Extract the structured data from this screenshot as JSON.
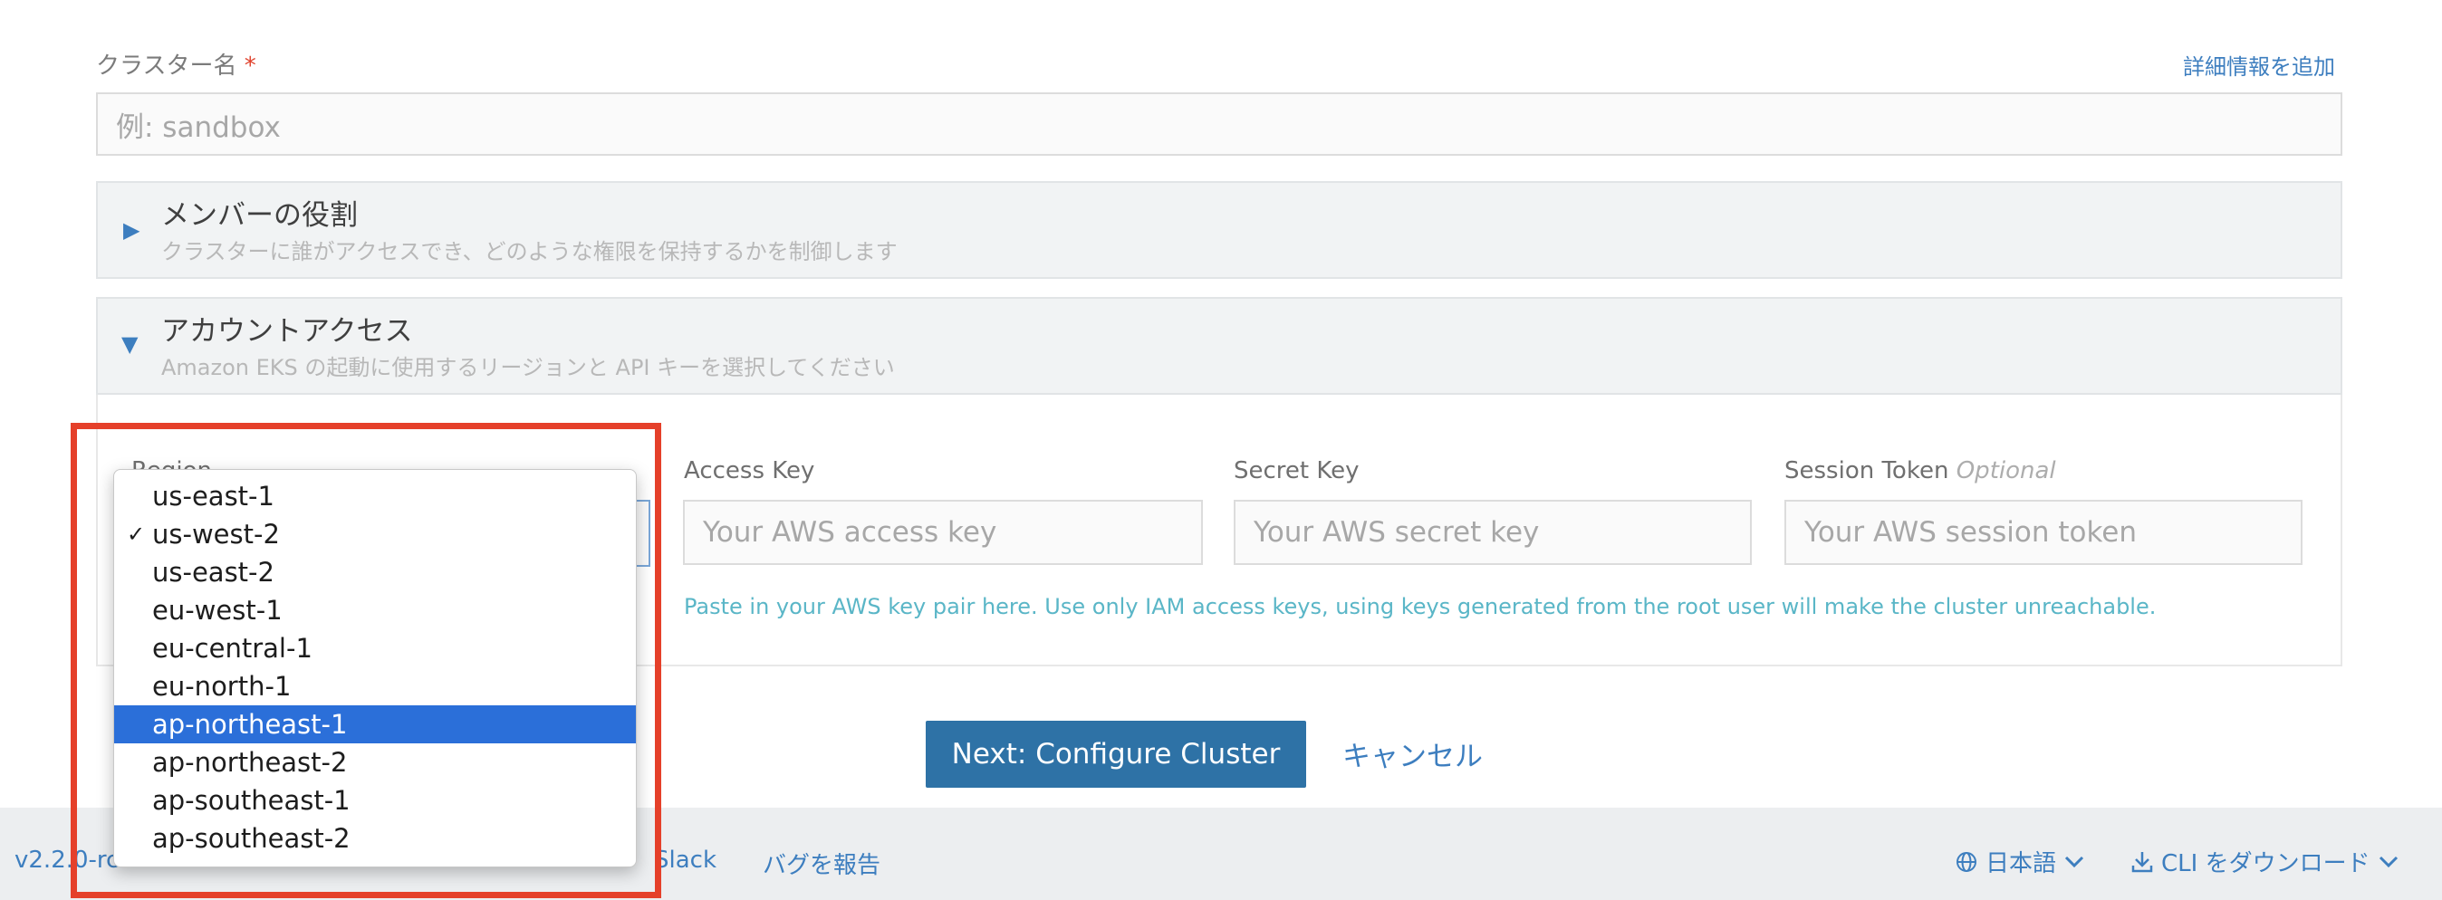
{
  "cluster_name": {
    "label": "クラスター名",
    "required_mark": "*",
    "add_details_link": "詳細情報を追加",
    "placeholder": "例: sandbox"
  },
  "member_roles": {
    "title": "メンバーの役割",
    "subtitle": "クラスターに誰がアクセスでき、どのような権限を保持するかを制御します"
  },
  "account_access": {
    "title": "アカウントアクセス",
    "subtitle": "Amazon EKS の起動に使用するリージョンと API キーを選択してください",
    "region_label": "Region",
    "access_key_label": "Access Key",
    "access_key_placeholder": "Your AWS access key",
    "secret_key_label": "Secret Key",
    "secret_key_placeholder": "Your AWS secret key",
    "session_token_label": "Session Token",
    "session_token_optional": "Optional",
    "session_token_placeholder": "Your AWS session token",
    "help_text": "Paste in your AWS key pair here. Use only IAM access keys, using keys generated from the root user will make the cluster unreachable."
  },
  "region_dropdown": {
    "selected_value": "us-west-2",
    "highlighted_value": "ap-northeast-1",
    "options": [
      "us-east-1",
      "us-west-2",
      "us-east-2",
      "eu-west-1",
      "eu-central-1",
      "eu-north-1",
      "ap-northeast-1",
      "ap-northeast-2",
      "ap-southeast-1",
      "ap-southeast-2"
    ]
  },
  "actions": {
    "next_label": "Next: Configure Cluster",
    "cancel_label": "キャンセル"
  },
  "footer": {
    "version": "v2.2.0-rc2",
    "links": [
      "Slack",
      "バグを報告"
    ],
    "language": "日本語",
    "download_cli": "CLI をダウンロード"
  },
  "colors": {
    "accent": "#3d7ebf",
    "primary_button": "#2e72a6",
    "selection": "#2b6fd9",
    "highlight_frame": "#e5402a"
  }
}
